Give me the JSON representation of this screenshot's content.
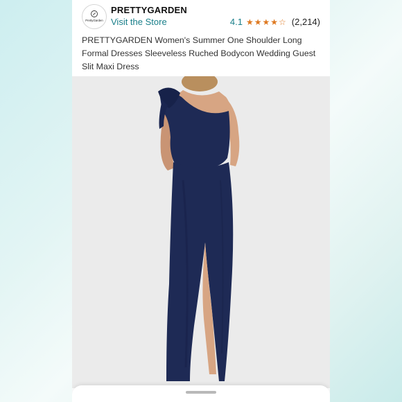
{
  "store": {
    "logo_text": "PrettyGarden",
    "brand_name": "PRETTYGARDEN",
    "visit_link": "Visit the Store"
  },
  "rating": {
    "value": "4.1",
    "stars": 4,
    "count": "(2,214)",
    "color": "#de7921"
  },
  "product": {
    "title": "PRETTYGARDEN Women's Summer One Shoulder Long Formal Dresses Sleeveless Ruched Bodycon Wedding Guest Slit Maxi Dress",
    "dress_color": "#1e2a55"
  },
  "icons": {
    "logo_mark": "leaf-circle-icon",
    "rating_star": "star-icon",
    "sheet_handle": "drag-handle"
  }
}
